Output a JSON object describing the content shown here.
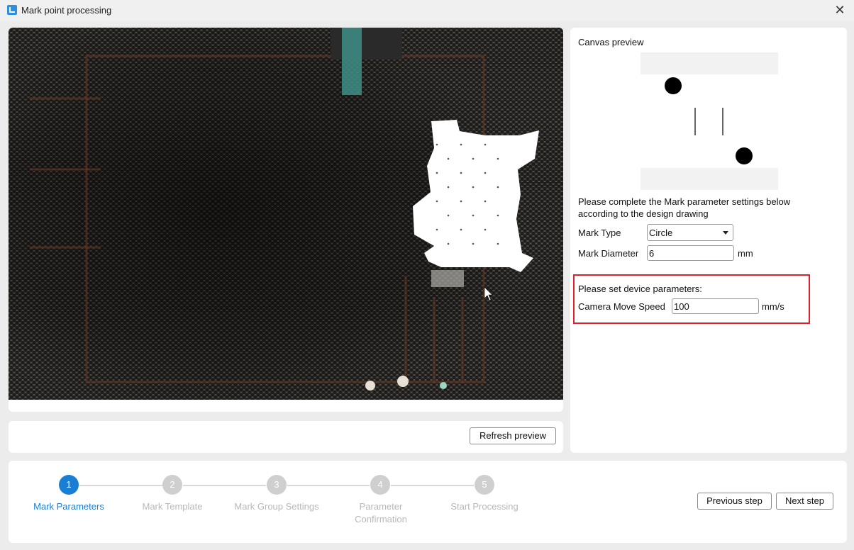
{
  "window": {
    "title": "Mark point processing",
    "close_icon": "✕"
  },
  "camera": {
    "refresh_label": "Refresh preview"
  },
  "settings": {
    "canvas_preview_title": "Canvas preview",
    "instruction": "Please complete the Mark parameter settings below according to the design drawing",
    "mark_type_label": "Mark Type",
    "mark_type_value": "Circle",
    "mark_diameter_label": "Mark Diameter",
    "mark_diameter_value": "6",
    "mark_diameter_unit": "mm",
    "device_title": "Please set device parameters:",
    "camera_speed_label": "Camera Move Speed",
    "camera_speed_value": "100",
    "camera_speed_unit": "mm/s"
  },
  "steps": [
    {
      "number": "1",
      "label": "Mark Parameters",
      "active": true
    },
    {
      "number": "2",
      "label": "Mark Template",
      "active": false
    },
    {
      "number": "3",
      "label": "Mark Group Settings",
      "active": false
    },
    {
      "number": "4",
      "label": "Parameter Confirmation",
      "active": false
    },
    {
      "number": "5",
      "label": "Start Processing",
      "active": false
    }
  ],
  "nav": {
    "previous_label": "Previous step",
    "next_label": "Next step"
  },
  "colors": {
    "accent": "#1a7fd4",
    "highlight": "#e0202a",
    "inactive_step": "#cfcfcf"
  }
}
